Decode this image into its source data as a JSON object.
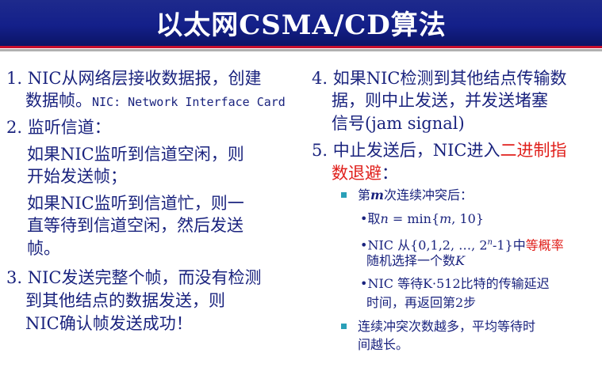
{
  "title": "以太网CSMA/CD算法",
  "left": {
    "item1_line1": "1. NIC从网络层接收数据报，创建",
    "item1_line2": "数据帧。",
    "item1_note": "NIC: Network Interface Card",
    "item2_line1": "2. 监听信道：",
    "item2_p1_line1": "如果NIC监听到信道空闲，则",
    "item2_p1_line2": "开始发送帧；",
    "item2_p2_line1": "如果NIC监听到信道忙，则一",
    "item2_p2_line2": "直等待到信道空闲，然后发送",
    "item2_p2_line3": "帧。",
    "item3_line1": "3. NIC发送完整个帧，而没有检测",
    "item3_line2": "到其他结点的数据发送，则",
    "item3_line3": "NIC确认帧发送成功！"
  },
  "right": {
    "item4_line1": "4. 如果NIC检测到其他结点传输数",
    "item4_line2": "据，则中止发送，并发送堵塞",
    "item4_line3": "信号(jam signal)",
    "item5_line1_a": "5. 中止发送后，NIC进入",
    "item5_line1_red": "二进制指",
    "item5_line2_red": "数退避",
    "item5_line2_end": "：",
    "sub1_a": "第",
    "sub1_m": "m",
    "sub1_b": "次连续冲突后：",
    "sub1a_a": "•取",
    "sub1a_n": "n",
    "sub1a_b": " = min{",
    "sub1a_m": "m",
    "sub1a_c": ", 10}",
    "sub1b_a": "•NIC 从{0,1,2, …, 2",
    "sub1b_sup": "n",
    "sub1b_b": "-1}中",
    "sub1b_red": "等概率",
    "sub1b_line2_a": "随机选择一个数",
    "sub1b_line2_k": "K",
    "sub1c_line1": "•NIC 等待K·512比特的传输延迟",
    "sub1c_line2": "时间，再返回第2步",
    "sub2_line1": "连续冲突次数越多，平均等待时",
    "sub2_line2": "间越长。"
  },
  "colors": {
    "title_bg": "#14208a",
    "text": "#1a237e",
    "highlight": "#e0201c",
    "bullet": "#2aa0b8"
  }
}
